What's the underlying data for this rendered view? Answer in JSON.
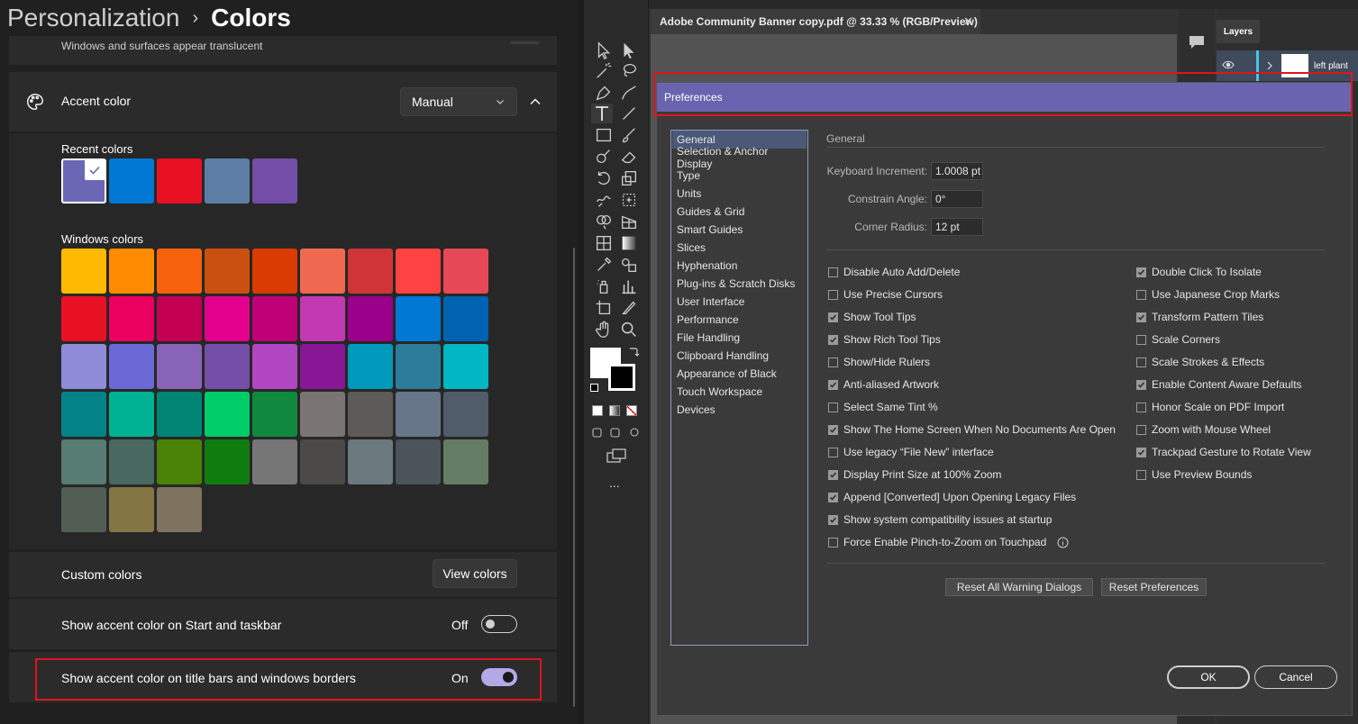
{
  "settings": {
    "breadcrumb": {
      "parent": "Personalization",
      "separator": "›",
      "current": "Colors"
    },
    "transparency_desc": "Windows and surfaces appear translucent",
    "accent": {
      "title": "Accent color",
      "mode": "Manual"
    },
    "recent_label": "Recent colors",
    "recent_colors": [
      "#6b67b5",
      "#0078d4",
      "#e81123",
      "#5c7ea5",
      "#744da9"
    ],
    "windows_label": "Windows colors",
    "windows_colors": [
      "#ffb900",
      "#ff8c00",
      "#f7630c",
      "#ca5010",
      "#da3b01",
      "#ef6950",
      "#d13438",
      "#ff4343",
      "#e74856",
      "#e81123",
      "#ea005e",
      "#c30052",
      "#e3008c",
      "#bf0077",
      "#c239b3",
      "#9a0089",
      "#0078d4",
      "#0063b1",
      "#8e8cd8",
      "#6b69d6",
      "#8764b8",
      "#744da9",
      "#b146c2",
      "#881798",
      "#0099bc",
      "#2d7d9a",
      "#00b7c3",
      "#038387",
      "#00b294",
      "#018574",
      "#00cc6a",
      "#10893e",
      "#7a7574",
      "#5d5a58",
      "#68768a",
      "#515c6b",
      "#567c73",
      "#486860",
      "#498205",
      "#107c10",
      "#767676",
      "#4c4a48",
      "#69797e",
      "#4a5459",
      "#647c64",
      "#525e54",
      "#847545",
      "#7e735f"
    ],
    "custom": {
      "label": "Custom colors",
      "button": "View colors"
    },
    "taskbar": {
      "label": "Show accent color on Start and taskbar",
      "state": "Off"
    },
    "titlebars": {
      "label": "Show accent color on title bars and windows borders",
      "state": "On"
    },
    "colors": {
      "highlight": "#e0141b",
      "toggle_on": "#b3a9e6"
    }
  },
  "illustrator": {
    "doc_tab": "Adobe Community Banner copy.pdf @ 33.33 % (RGB/Preview)",
    "tab_close": "✕",
    "layers_tab": "Layers",
    "layer_name": "left plant",
    "more": "...",
    "prefs": {
      "title": "Preferences",
      "group": "General",
      "categories": [
        "General",
        "Selection & Anchor Display",
        "Type",
        "Units",
        "Guides & Grid",
        "Smart Guides",
        "Slices",
        "Hyphenation",
        "Plug-ins & Scratch Disks",
        "User Interface",
        "Performance",
        "File Handling",
        "Clipboard Handling",
        "Appearance of Black",
        "Touch Workspace",
        "Devices"
      ],
      "fields": [
        {
          "label": "Keyboard Increment:",
          "value": "1.0008 pt"
        },
        {
          "label": "Constrain Angle:",
          "value": "0°"
        },
        {
          "label": "Corner Radius:",
          "value": "12 pt"
        }
      ],
      "left_checks": [
        {
          "label": "Disable Auto Add/Delete",
          "checked": false
        },
        {
          "label": "Use Precise Cursors",
          "checked": false
        },
        {
          "label": "Show Tool Tips",
          "checked": true
        },
        {
          "label": "Show Rich Tool Tips",
          "checked": true
        },
        {
          "label": "Show/Hide Rulers",
          "checked": false
        },
        {
          "label": "Anti-aliased Artwork",
          "checked": true
        },
        {
          "label": "Select Same Tint %",
          "checked": false
        },
        {
          "label": "Show The Home Screen When No Documents Are Open",
          "checked": true
        },
        {
          "label": "Use legacy “File New” interface",
          "checked": false
        },
        {
          "label": "Display Print Size at 100% Zoom",
          "checked": true
        },
        {
          "label": "Append [Converted] Upon Opening Legacy Files",
          "checked": true
        },
        {
          "label": "Show system compatibility issues at startup",
          "checked": true
        },
        {
          "label": "Force Enable Pinch-to-Zoom on Touchpad",
          "checked": false
        }
      ],
      "right_checks": [
        {
          "label": "Double Click To Isolate",
          "checked": true
        },
        {
          "label": "Use Japanese Crop Marks",
          "checked": false
        },
        {
          "label": "Transform Pattern Tiles",
          "checked": true
        },
        {
          "label": "Scale Corners",
          "checked": false
        },
        {
          "label": "Scale Strokes & Effects",
          "checked": false
        },
        {
          "label": "Enable Content Aware Defaults",
          "checked": true
        },
        {
          "label": "Honor Scale on PDF Import",
          "checked": false
        },
        {
          "label": "Zoom with Mouse Wheel",
          "checked": false
        },
        {
          "label": "Trackpad Gesture to Rotate View",
          "checked": true
        },
        {
          "label": "Use Preview Bounds",
          "checked": false
        }
      ],
      "reset_warnings": "Reset All Warning Dialogs",
      "reset_prefs": "Reset Preferences",
      "ok": "OK",
      "cancel": "Cancel",
      "title_color": "#6a64b0"
    }
  }
}
